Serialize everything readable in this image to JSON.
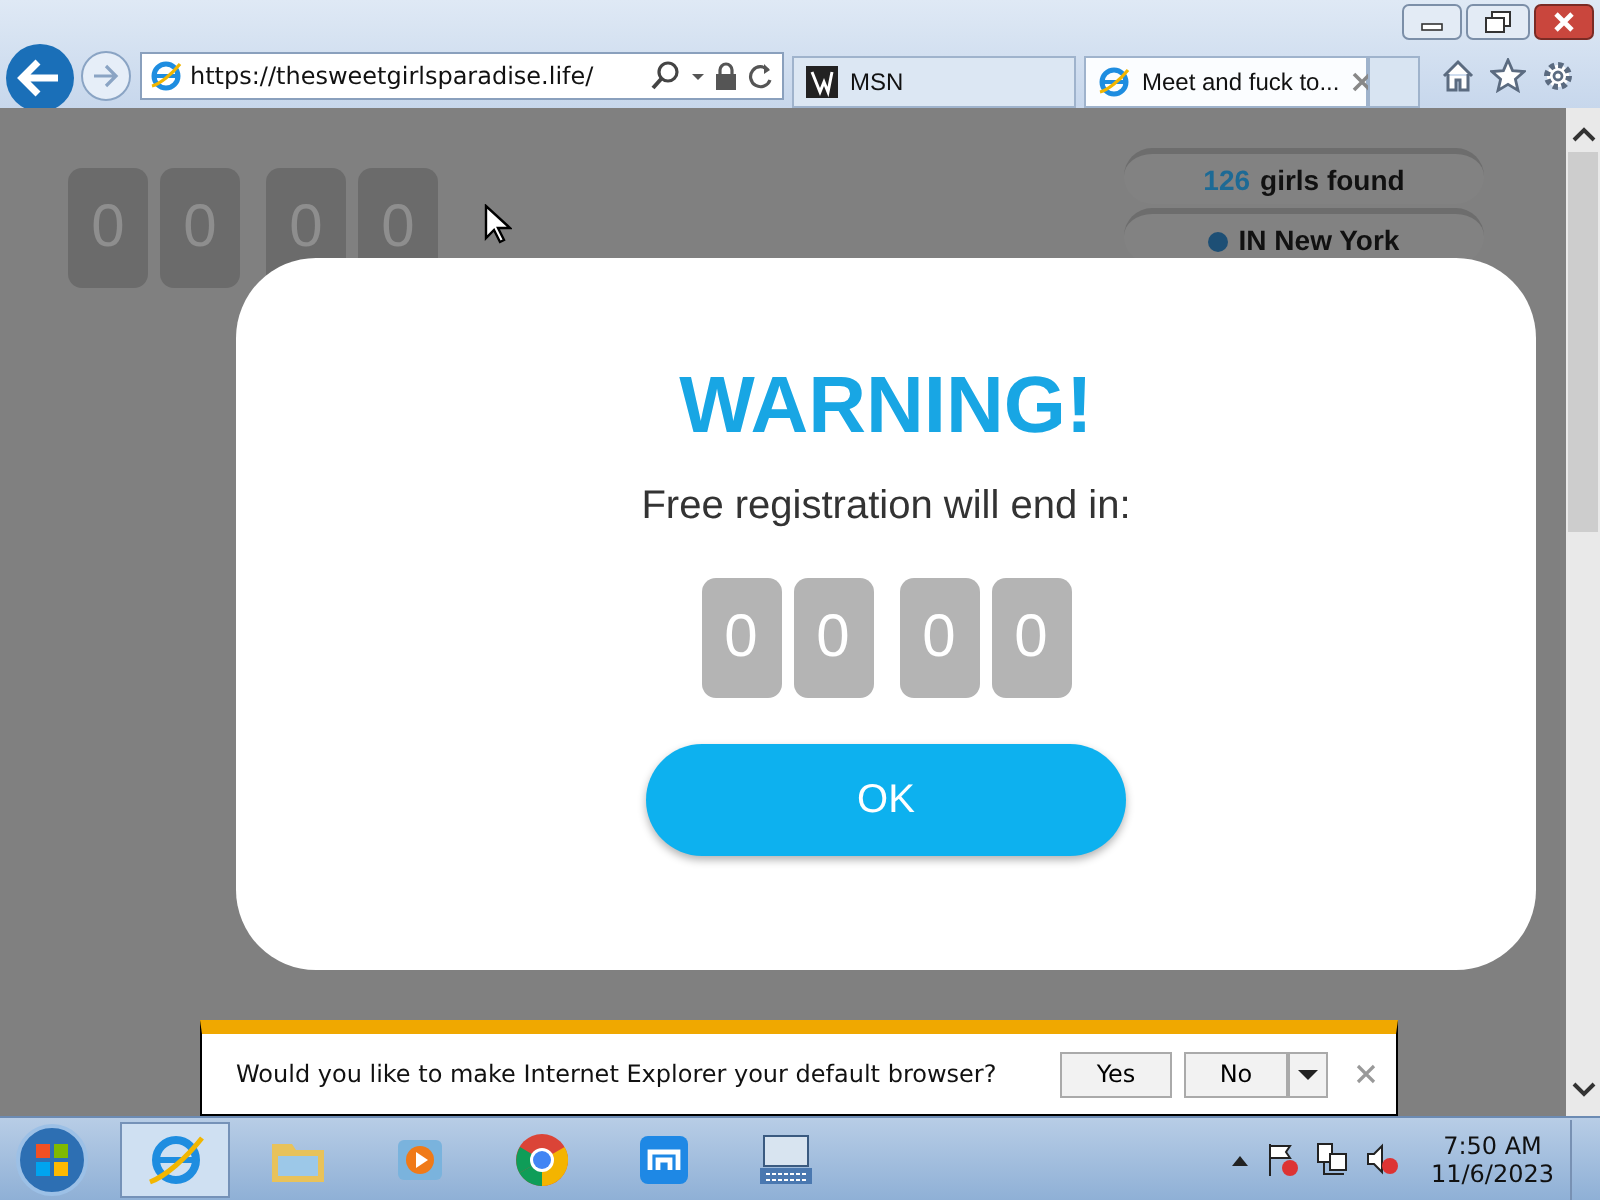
{
  "browser": {
    "address": "https://thesweetgirlsparadise.life/",
    "tabs": [
      {
        "title": "MSN",
        "kind": "msn",
        "selected": false
      },
      {
        "title": "Meet and fuck to...",
        "kind": "ie",
        "selected": true
      }
    ]
  },
  "page": {
    "counter": [
      "0",
      "0",
      "0",
      "0"
    ],
    "found_count": "126",
    "found_label": "girls found",
    "location": "IN New York"
  },
  "modal": {
    "title": "WARNING!",
    "message": "Free registration will end in:",
    "digits": [
      "0",
      "0",
      "0",
      "0"
    ],
    "button": "OK"
  },
  "notification": {
    "message": "Would you like to make Internet Explorer your default browser?",
    "yes": "Yes",
    "no": "No"
  },
  "taskbar": {
    "apps": [
      {
        "kind": "ie",
        "selected": true
      },
      {
        "kind": "folder",
        "selected": false
      },
      {
        "kind": "media",
        "selected": false
      },
      {
        "kind": "chrome",
        "selected": false
      },
      {
        "kind": "maxthon",
        "selected": false
      },
      {
        "kind": "keyboard",
        "selected": false
      }
    ],
    "time": "7:50 AM",
    "date": "11/6/2023"
  }
}
